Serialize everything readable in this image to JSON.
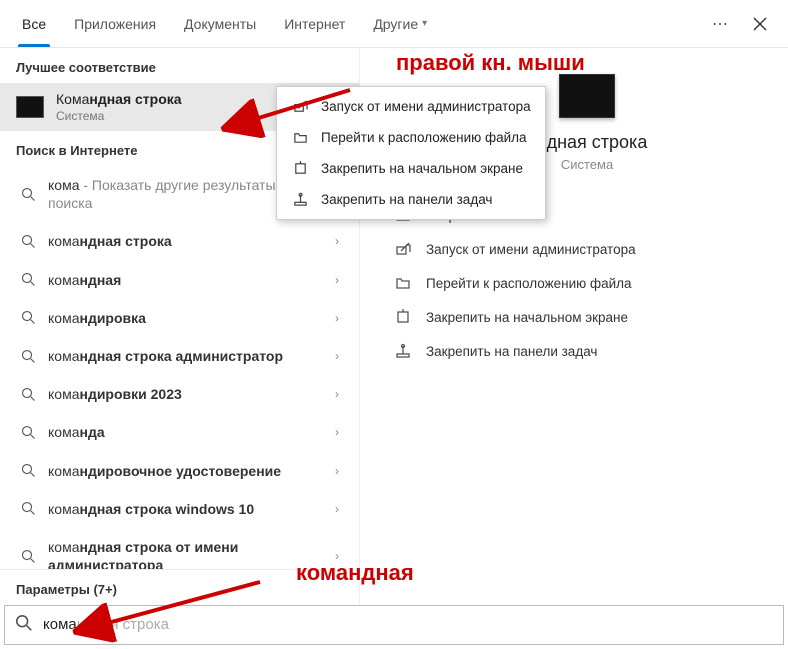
{
  "tabs": {
    "all": "Все",
    "apps": "Приложения",
    "docs": "Документы",
    "internet": "Интернет",
    "other": "Другие"
  },
  "left": {
    "best_match_header": "Лучшее соответствие",
    "best_match": {
      "title_pre": "Кома",
      "title_bold": "ндная строка",
      "subtitle": "Система"
    },
    "internet_header": "Поиск в Интернете",
    "items": [
      {
        "pre": "кома",
        "post": " - Показать другие результаты поиска",
        "light_post": true,
        "chev": true
      },
      {
        "pre": "кома",
        "bold": "ндная строка",
        "chev": true
      },
      {
        "pre": "кома",
        "bold": "ндная",
        "chev": true
      },
      {
        "pre": "кома",
        "bold": "ндировка",
        "chev": true
      },
      {
        "pre": "кома",
        "bold": "ндная строка администратор",
        "chev": true
      },
      {
        "pre": "кома",
        "bold": "ндировки 2023",
        "chev": true
      },
      {
        "pre": "кома",
        "bold": "нда",
        "chev": true
      },
      {
        "pre": "кома",
        "bold": "ндировочное удостоверение",
        "chev": true
      },
      {
        "pre": "кома",
        "bold": "ндная строка windows 10",
        "chev": true
      },
      {
        "pre": "кома",
        "bold": "ндная строка от имени администратора",
        "chev": true
      }
    ],
    "params_header": "Параметры (7+)"
  },
  "right": {
    "title_suffix": "андная строка",
    "subtitle": "Система",
    "actions": [
      {
        "icon": "open",
        "label": "Открыть"
      },
      {
        "icon": "admin",
        "label": "Запуск от имени администратора"
      },
      {
        "icon": "folder",
        "label": "Перейти к расположению файла"
      },
      {
        "icon": "pin-start",
        "label": "Закрепить на начальном экране"
      },
      {
        "icon": "pin-task",
        "label": "Закрепить на панели задач"
      }
    ]
  },
  "context_menu": [
    {
      "icon": "admin",
      "label": "Запуск от имени администратора"
    },
    {
      "icon": "folder",
      "label": "Перейти к расположению файла"
    },
    {
      "icon": "pin-start",
      "label": "Закрепить на начальном экране"
    },
    {
      "icon": "pin-task",
      "label": "Закрепить на панели задач"
    }
  ],
  "search": {
    "typed": "кома",
    "ghost": "ндная строка"
  },
  "annotations": {
    "top_right": "правой кн. мыши",
    "bottom": "командная"
  }
}
